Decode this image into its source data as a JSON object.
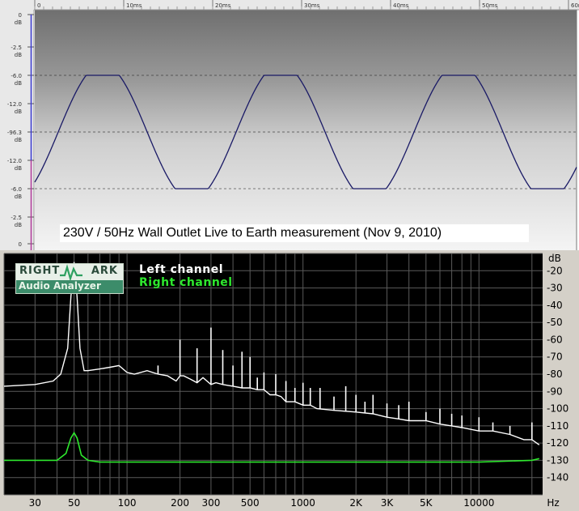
{
  "waveform": {
    "caption": "230V / 50Hz Wall Outlet Live to Earth measurement (Nov 9, 2010)",
    "time_ticks": [
      "0",
      "10ms",
      "20ms",
      "30ms",
      "40ms",
      "50ms",
      "60ms"
    ],
    "db_ticks": [
      "0 dB",
      "-2.5 dB",
      "-6.0 dB",
      "-12.0 dB",
      "-96.3 dB",
      "-12.0 dB",
      "-6.0 dB",
      "-2.5 dB",
      "0"
    ],
    "colors": {
      "trace": "#1a1a66",
      "plot_top": "#6f6f6f",
      "plot_bottom": "#f2f2f2",
      "ruler": "#e8e8e8"
    }
  },
  "chart_data": {
    "type": "line",
    "title": "",
    "xlabel": "Hz",
    "ylabel": "dB",
    "xscale": "log",
    "xlim": [
      20,
      23000
    ],
    "ylim": [
      -150,
      -10
    ],
    "x_ticks": [
      "30",
      "50",
      "100",
      "200",
      "300",
      "500",
      "1000",
      "2K",
      "3K",
      "5K",
      "10000"
    ],
    "y_ticks": [
      "-20",
      "-30",
      "-40",
      "-50",
      "-60",
      "-70",
      "-80",
      "-90",
      "-100",
      "-110",
      "-120",
      "-130",
      "-140"
    ],
    "grid": true,
    "legend_position": "top-left",
    "legend_title": "RIGHT MARK Audio Analyzer",
    "series": [
      {
        "name": "Left channel",
        "color": "#ffffff",
        "x": [
          20,
          30,
          38,
          42,
          46,
          48,
          50,
          52,
          54,
          57,
          60,
          70,
          80,
          90,
          100,
          110,
          130,
          150,
          170,
          190,
          200,
          210,
          230,
          250,
          270,
          300,
          320,
          350,
          400,
          450,
          500,
          550,
          600,
          650,
          700,
          750,
          800,
          900,
          1000,
          1100,
          1200,
          1500,
          2000,
          2500,
          3000,
          3500,
          4000,
          5000,
          6000,
          7000,
          8000,
          10000,
          12000,
          15000,
          18000,
          20000,
          22000
        ],
        "y": [
          -87,
          -86,
          -84,
          -80,
          -65,
          -35,
          -15,
          -35,
          -65,
          -78,
          -78,
          -77,
          -76,
          -75,
          -79,
          -80,
          -78,
          -80,
          -81,
          -84,
          -81,
          -81,
          -83,
          -85,
          -82,
          -86,
          -85,
          -86,
          -87,
          -88,
          -88,
          -89,
          -89,
          -92,
          -92,
          -93,
          -96,
          -96,
          -98,
          -98,
          -100,
          -101,
          -102,
          -103,
          -105,
          -106,
          -107,
          -107,
          -109,
          -110,
          -111,
          -113,
          -113,
          -115,
          -118,
          -118,
          -121
        ]
      },
      {
        "name": "Right channel",
        "color": "#2ee82e",
        "x": [
          20,
          30,
          40,
          45,
          48,
          50,
          52,
          55,
          60,
          70,
          100,
          200,
          500,
          1000,
          2000,
          5000,
          10000,
          20000,
          22000
        ],
        "y": [
          -130,
          -130,
          -130,
          -126,
          -117,
          -114,
          -117,
          -127,
          -130,
          -131,
          -131,
          -131,
          -131,
          -131,
          -131,
          -131,
          -131,
          -130,
          -129
        ]
      }
    ],
    "peaks": [
      {
        "f": 50,
        "db": -15
      },
      {
        "f": 150,
        "db": -75
      },
      {
        "f": 200,
        "db": -60
      },
      {
        "f": 250,
        "db": -65
      },
      {
        "f": 300,
        "db": -53
      },
      {
        "f": 350,
        "db": -66
      },
      {
        "f": 400,
        "db": -75
      },
      {
        "f": 450,
        "db": -67
      },
      {
        "f": 500,
        "db": -70
      },
      {
        "f": 550,
        "db": -82
      },
      {
        "f": 600,
        "db": -79
      },
      {
        "f": 700,
        "db": -80
      },
      {
        "f": 800,
        "db": -84
      },
      {
        "f": 900,
        "db": -88
      },
      {
        "f": 1000,
        "db": -85
      },
      {
        "f": 1100,
        "db": -88
      },
      {
        "f": 1250,
        "db": -88
      },
      {
        "f": 1500,
        "db": -93
      },
      {
        "f": 1750,
        "db": -87
      },
      {
        "f": 2000,
        "db": -92
      },
      {
        "f": 2250,
        "db": -96
      },
      {
        "f": 2500,
        "db": -92
      },
      {
        "f": 3000,
        "db": -97
      },
      {
        "f": 3500,
        "db": -98
      },
      {
        "f": 4000,
        "db": -96
      },
      {
        "f": 5000,
        "db": -102
      },
      {
        "f": 6000,
        "db": -100
      },
      {
        "f": 7000,
        "db": -103
      },
      {
        "f": 8000,
        "db": -104
      },
      {
        "f": 10000,
        "db": -105
      },
      {
        "f": 12000,
        "db": -108
      },
      {
        "f": 15000,
        "db": -110
      },
      {
        "f": 20000,
        "db": -108
      }
    ]
  },
  "spectrum_colors": {
    "background": "#000000",
    "grid": "#5a5a5a",
    "axis_panel": "#d4d0c8"
  }
}
